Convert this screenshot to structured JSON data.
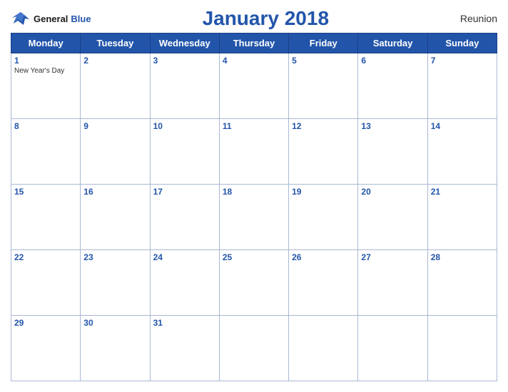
{
  "header": {
    "logo_general": "General",
    "logo_blue": "Blue",
    "title": "January 2018",
    "region": "Reunion"
  },
  "weekdays": [
    "Monday",
    "Tuesday",
    "Wednesday",
    "Thursday",
    "Friday",
    "Saturday",
    "Sunday"
  ],
  "weeks": [
    [
      {
        "day": "1",
        "holiday": "New Year's Day"
      },
      {
        "day": "2",
        "holiday": ""
      },
      {
        "day": "3",
        "holiday": ""
      },
      {
        "day": "4",
        "holiday": ""
      },
      {
        "day": "5",
        "holiday": ""
      },
      {
        "day": "6",
        "holiday": ""
      },
      {
        "day": "7",
        "holiday": ""
      }
    ],
    [
      {
        "day": "8",
        "holiday": ""
      },
      {
        "day": "9",
        "holiday": ""
      },
      {
        "day": "10",
        "holiday": ""
      },
      {
        "day": "11",
        "holiday": ""
      },
      {
        "day": "12",
        "holiday": ""
      },
      {
        "day": "13",
        "holiday": ""
      },
      {
        "day": "14",
        "holiday": ""
      }
    ],
    [
      {
        "day": "15",
        "holiday": ""
      },
      {
        "day": "16",
        "holiday": ""
      },
      {
        "day": "17",
        "holiday": ""
      },
      {
        "day": "18",
        "holiday": ""
      },
      {
        "day": "19",
        "holiday": ""
      },
      {
        "day": "20",
        "holiday": ""
      },
      {
        "day": "21",
        "holiday": ""
      }
    ],
    [
      {
        "day": "22",
        "holiday": ""
      },
      {
        "day": "23",
        "holiday": ""
      },
      {
        "day": "24",
        "holiday": ""
      },
      {
        "day": "25",
        "holiday": ""
      },
      {
        "day": "26",
        "holiday": ""
      },
      {
        "day": "27",
        "holiday": ""
      },
      {
        "day": "28",
        "holiday": ""
      }
    ],
    [
      {
        "day": "29",
        "holiday": ""
      },
      {
        "day": "30",
        "holiday": ""
      },
      {
        "day": "31",
        "holiday": ""
      },
      {
        "day": "",
        "holiday": ""
      },
      {
        "day": "",
        "holiday": ""
      },
      {
        "day": "",
        "holiday": ""
      },
      {
        "day": "",
        "holiday": ""
      }
    ]
  ]
}
